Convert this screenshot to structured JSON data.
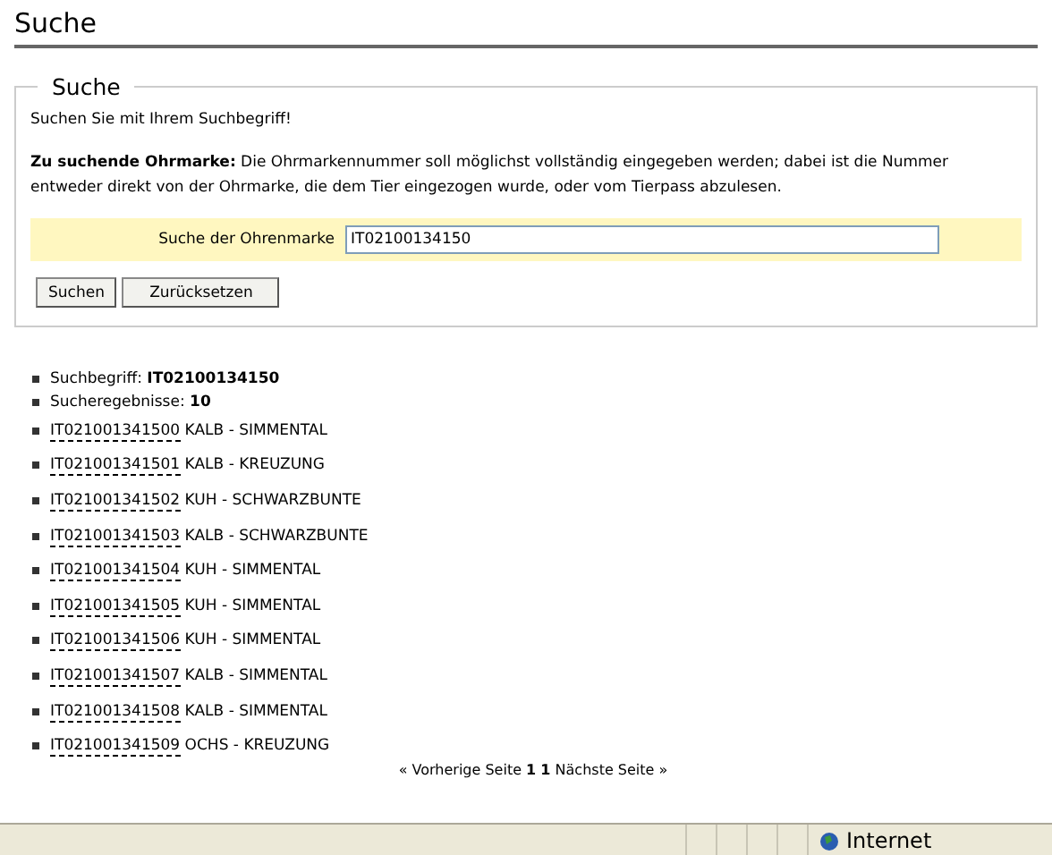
{
  "page_title": "Suche",
  "search_form": {
    "legend": "Suche",
    "intro": "Suchen Sie mit Ihrem Suchbegriff!",
    "hint": "**Zu suchende Ohrmarke:** Die Ohrmarkennummer soll möglichst vollständig eingegeben werden; dabei ist die Nummer entweder direkt von der Ohrmarke, die dem Tier eingezogen wurde, oder vom Tierpass abzulesen.",
    "field_label": "Suche der Ohrenmarke",
    "field_value": "IT02100134150",
    "buttons": [
      "Suchen",
      "Zurücksetzen"
    ]
  },
  "summary": [
    "Suchbegriff: **IT02100134150**",
    "Sucheregebnisse: **10**"
  ],
  "results": [
    {
      "ear_tag": "IT021001341500",
      "description": "KALB - SIMMENTAL"
    },
    {
      "ear_tag": "IT021001341501",
      "description": "KALB - KREUZUNG"
    },
    {
      "ear_tag": "IT021001341502",
      "description": "KUH - SCHWARZBUNTE"
    },
    {
      "ear_tag": "IT021001341503",
      "description": "KALB - SCHWARZBUNTE"
    },
    {
      "ear_tag": "IT021001341504",
      "description": "KUH - SIMMENTAL"
    },
    {
      "ear_tag": "IT021001341505",
      "description": "KUH - SIMMENTAL"
    },
    {
      "ear_tag": "IT021001341506",
      "description": "KUH - SIMMENTAL"
    },
    {
      "ear_tag": "IT021001341507",
      "description": "KALB - SIMMENTAL"
    },
    {
      "ear_tag": "IT021001341508",
      "description": "KALB - SIMMENTAL"
    },
    {
      "ear_tag": "IT021001341509",
      "description": "OCHS - KREUZUNG"
    }
  ],
  "pager": {
    "previous": "« Vorherige Seite",
    "pages": [
      "1",
      "1"
    ],
    "next": "Nächste Seite »"
  },
  "status_bar": {
    "zone": "Internet"
  }
}
